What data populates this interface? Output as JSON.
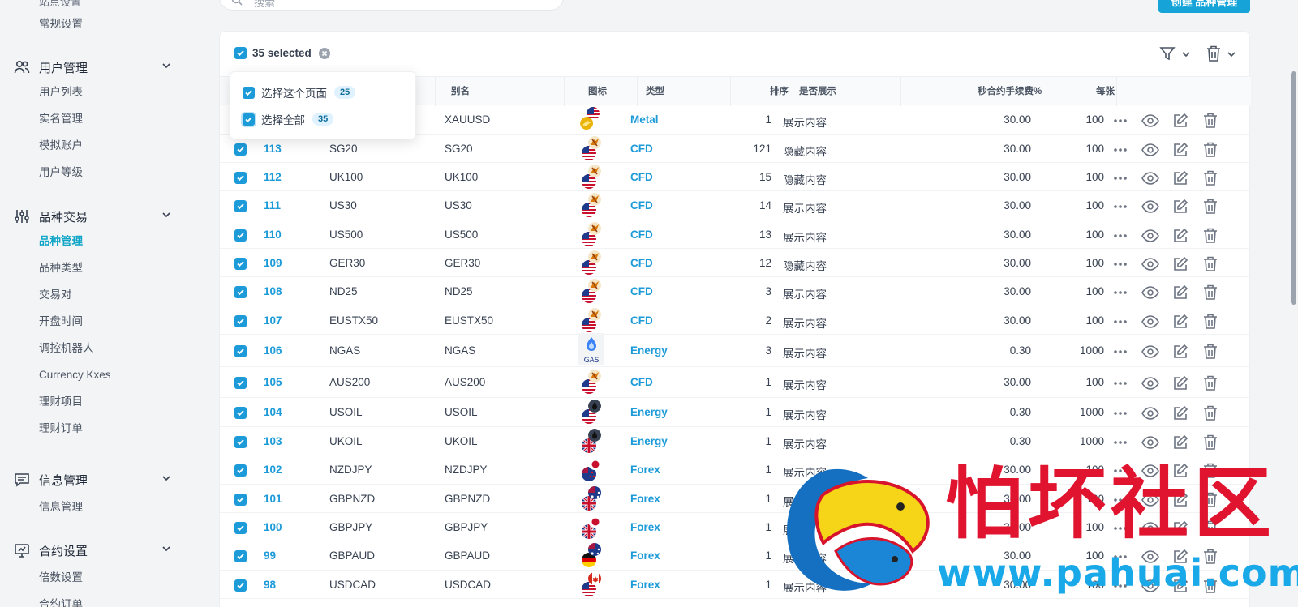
{
  "sidebar": {
    "cut_item": "站点设置",
    "top_item": "常规设置",
    "groups": [
      {
        "title": "用户管理",
        "icon": "users-icon",
        "items": [
          "用户列表",
          "实名管理",
          "模拟账户",
          "用户等级"
        ]
      },
      {
        "title": "品种交易",
        "icon": "sliders-icon",
        "items": [
          "品种管理",
          "品种类型",
          "交易对",
          "开盘时间",
          "调控机器人",
          "Currency Kxes",
          "理财项目",
          "理财订单"
        ]
      },
      {
        "title": "信息管理",
        "icon": "message-icon",
        "items": [
          "信息管理"
        ]
      },
      {
        "title": "合约设置",
        "icon": "monitor-icon",
        "items": [
          "倍数设置",
          "合约订单"
        ]
      }
    ],
    "active_item": "品种管理"
  },
  "search": {
    "placeholder": "搜索"
  },
  "create_button": "创建 品种管理",
  "selection": {
    "label": "35 selected"
  },
  "popover": {
    "select_page": {
      "label": "选择这个页面",
      "count": "25"
    },
    "select_all": {
      "label": "选择全部",
      "count": "35"
    }
  },
  "table": {
    "headers": {
      "alias": "别名",
      "icon": "图标",
      "type": "类型",
      "sort": "排序",
      "display": "是否展示",
      "fee": "秒合约手续费%",
      "per": "每张"
    },
    "rows": [
      {
        "id": "",
        "name": "",
        "alias": "XAUUSD",
        "flag": "gold",
        "type": "Metal",
        "sort": "1",
        "display": "展示内容",
        "fee": "30.00",
        "per": "100"
      },
      {
        "id": "113",
        "name": "SG20",
        "alias": "SG20",
        "flag": "cfd",
        "type": "CFD",
        "sort": "121",
        "display": "隐藏内容",
        "fee": "30.00",
        "per": "100"
      },
      {
        "id": "112",
        "name": "UK100",
        "alias": "UK100",
        "flag": "cfd",
        "type": "CFD",
        "sort": "15",
        "display": "隐藏内容",
        "fee": "30.00",
        "per": "100"
      },
      {
        "id": "111",
        "name": "US30",
        "alias": "US30",
        "flag": "cfd",
        "type": "CFD",
        "sort": "14",
        "display": "展示内容",
        "fee": "30.00",
        "per": "100"
      },
      {
        "id": "110",
        "name": "US500",
        "alias": "US500",
        "flag": "cfd",
        "type": "CFD",
        "sort": "13",
        "display": "展示内容",
        "fee": "30.00",
        "per": "100"
      },
      {
        "id": "109",
        "name": "GER30",
        "alias": "GER30",
        "flag": "cfd",
        "type": "CFD",
        "sort": "12",
        "display": "隐藏内容",
        "fee": "30.00",
        "per": "100"
      },
      {
        "id": "108",
        "name": "ND25",
        "alias": "ND25",
        "flag": "cfd",
        "type": "CFD",
        "sort": "3",
        "display": "展示内容",
        "fee": "30.00",
        "per": "100"
      },
      {
        "id": "107",
        "name": "EUSTX50",
        "alias": "EUSTX50",
        "flag": "cfd",
        "type": "CFD",
        "sort": "2",
        "display": "展示内容",
        "fee": "30.00",
        "per": "100"
      },
      {
        "id": "106",
        "name": "NGAS",
        "alias": "NGAS",
        "flag": "gas",
        "type": "Energy",
        "sort": "3",
        "display": "展示内容",
        "fee": "0.30",
        "per": "1000"
      },
      {
        "id": "105",
        "name": "AUS200",
        "alias": "AUS200",
        "flag": "cfd",
        "type": "CFD",
        "sort": "1",
        "display": "展示内容",
        "fee": "30.00",
        "per": "100"
      },
      {
        "id": "104",
        "name": "USOIL",
        "alias": "USOIL",
        "flag": "oil-us",
        "type": "Energy",
        "sort": "1",
        "display": "展示内容",
        "fee": "0.30",
        "per": "1000"
      },
      {
        "id": "103",
        "name": "UKOIL",
        "alias": "UKOIL",
        "flag": "oil-uk",
        "type": "Energy",
        "sort": "1",
        "display": "展示内容",
        "fee": "0.30",
        "per": "1000"
      },
      {
        "id": "102",
        "name": "NZDJPY",
        "alias": "NZDJPY",
        "flag": "nzd-jpy",
        "type": "Forex",
        "sort": "1",
        "display": "展示内容",
        "fee": "30.00",
        "per": "100"
      },
      {
        "id": "101",
        "name": "GBPNZD",
        "alias": "GBPNZD",
        "flag": "gbp-nzd",
        "type": "Forex",
        "sort": "1",
        "display": "展示内容",
        "fee": "30.00",
        "per": "100"
      },
      {
        "id": "100",
        "name": "GBPJPY",
        "alias": "GBPJPY",
        "flag": "gbp-jpy",
        "type": "Forex",
        "sort": "1",
        "display": "展示内容",
        "fee": "30.00",
        "per": "100"
      },
      {
        "id": "99",
        "name": "GBPAUD",
        "alias": "GBPAUD",
        "flag": "gbp-aud",
        "type": "Forex",
        "sort": "1",
        "display": "展示内容",
        "fee": "30.00",
        "per": "100"
      },
      {
        "id": "98",
        "name": "USDCAD",
        "alias": "USDCAD",
        "flag": "usd-cad",
        "type": "Forex",
        "sort": "1",
        "display": "展示内容",
        "fee": "30.00",
        "per": "100"
      }
    ]
  },
  "watermark": {
    "title": "怕坏社区",
    "url": "www.pahuai.com"
  },
  "colors": {
    "accent": "#1d9bd8",
    "watermark_red": "#e0142f",
    "watermark_blue": "#1aa9e8"
  }
}
